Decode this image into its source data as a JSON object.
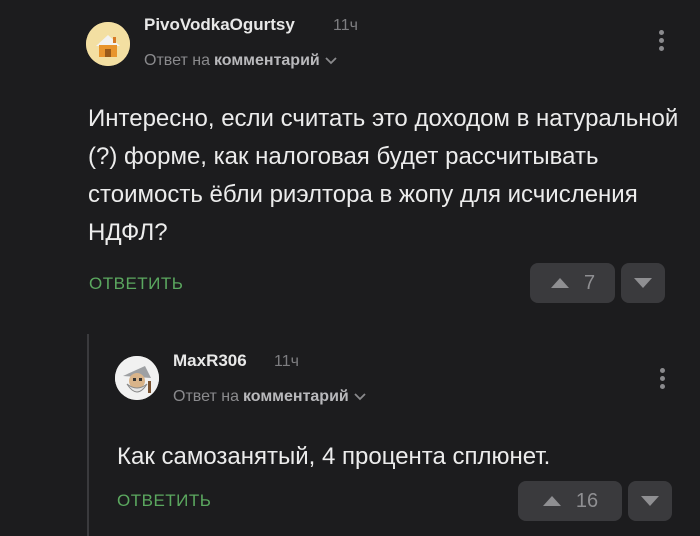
{
  "comments": [
    {
      "author": "PivoVodkaOgurtsy",
      "time": "11ч",
      "reply_prefix": "Ответ на",
      "reply_target": "комментарий",
      "text": "Интересно, если считать это доходом в натуральной (?) форме, как налоговая будет рассчитывать стоимость ёбли риэлтора в жопу для исчисления НДФЛ?",
      "reply_label": "ОТВЕТИТЬ",
      "score": "7"
    },
    {
      "author": "MaxR306",
      "time": "11ч",
      "reply_prefix": "Ответ на",
      "reply_target": "комментарий",
      "text": "Как самозанятый, 4 процента сплюнет.",
      "reply_label": "ОТВЕТИТЬ",
      "score": "16"
    }
  ],
  "colors": {
    "background": "#1c1c1e",
    "reply_green": "#5ba85f",
    "button_bg": "#3a3a3d"
  }
}
